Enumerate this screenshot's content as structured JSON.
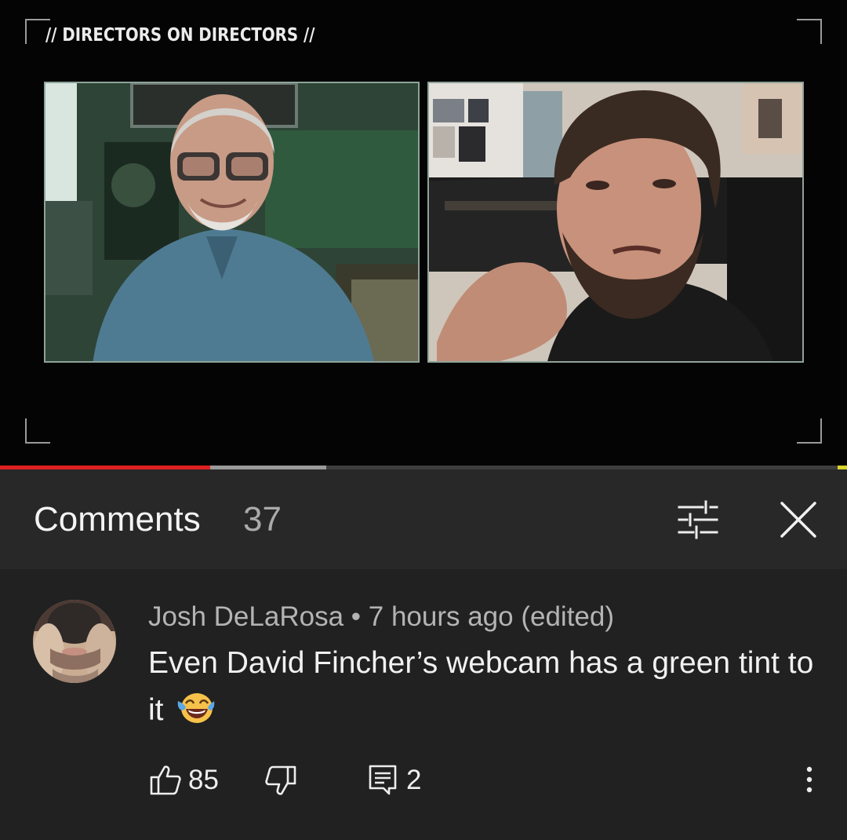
{
  "video": {
    "show_title": "// DIRECTORS ON DIRECTORS //",
    "progress_played_fraction": 0.248,
    "progress_buffered_fraction": 0.385
  },
  "comments_header": {
    "title": "Comments",
    "count": "37",
    "filter_icon": "sort-filter-icon",
    "close_icon": "close-icon"
  },
  "comment": {
    "author": "Josh DeLaRosa",
    "separator": " • ",
    "time": "7 hours ago",
    "edited": " (edited)",
    "text": "Even David Fincher’s webcam has a green tint to it",
    "emoji": "face-with-tears-of-joy",
    "likes": "85",
    "replies": "2",
    "icons": {
      "like": "thumbs-up-icon",
      "dislike": "thumbs-down-icon",
      "reply": "reply-icon",
      "more": "more-vertical-icon"
    }
  },
  "colors": {
    "background": "#212121",
    "header_background": "#282828",
    "progress_played": "#e02020",
    "progress_buffered": "#9a9a9a",
    "feed_border": "#8fa39a"
  }
}
